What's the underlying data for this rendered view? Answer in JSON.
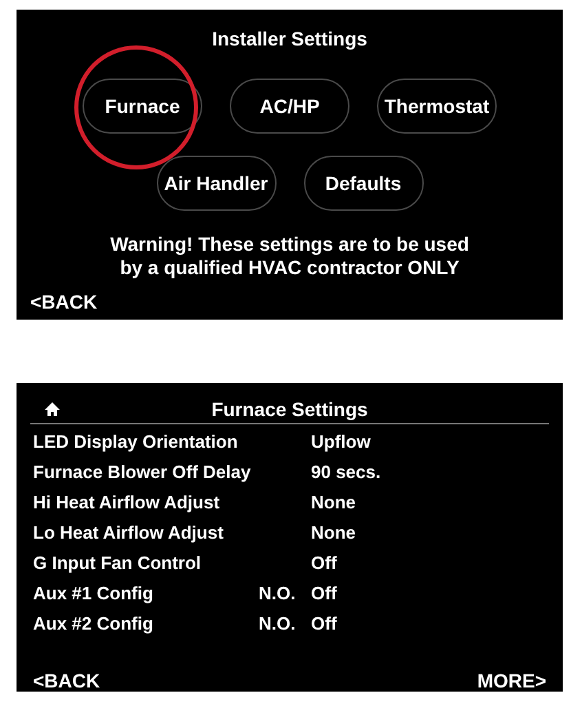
{
  "installer_screen": {
    "title": "Installer Settings",
    "button_rows": [
      [
        {
          "label": "Furnace",
          "highlighted": true
        },
        {
          "label": "AC/HP",
          "highlighted": false
        },
        {
          "label": "Thermostat",
          "highlighted": false
        }
      ],
      [
        {
          "label": "Air Handler",
          "highlighted": false
        },
        {
          "label": "Defaults",
          "highlighted": false
        }
      ]
    ],
    "warning": [
      "Warning! These settings are to be used",
      "by a qualified HVAC contractor ONLY"
    ],
    "back": "<BACK"
  },
  "furnace_screen": {
    "title": "Furnace Settings",
    "settings": [
      {
        "label": "LED Display Orientation",
        "value": "Upflow"
      },
      {
        "label": "Furnace Blower Off Delay",
        "value": "90 secs."
      },
      {
        "label": "Hi Heat Airflow Adjust",
        "value": "None"
      },
      {
        "label": "Lo Heat Airflow Adjust",
        "value": "None"
      },
      {
        "label": "G Input Fan Control",
        "value": "Off"
      },
      {
        "label": "Aux #1 Config",
        "mode": "N.O.",
        "value": "Off"
      },
      {
        "label": "Aux #2 Config",
        "mode": "N.O.",
        "value": "Off"
      }
    ],
    "back": "<BACK",
    "more": "MORE>"
  }
}
